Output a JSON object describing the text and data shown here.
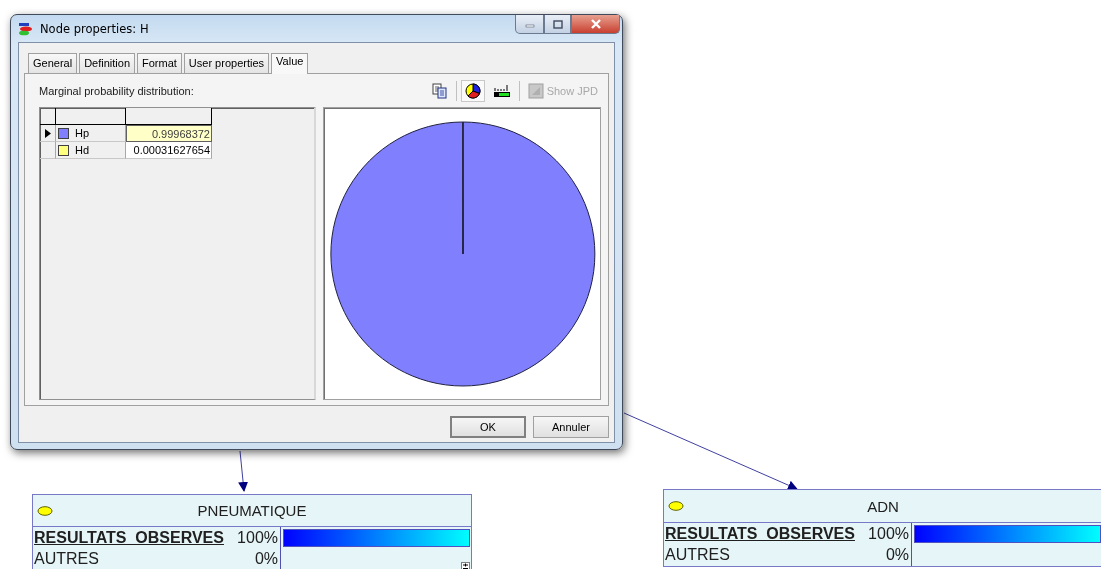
{
  "dialog": {
    "title": "Node properties: H",
    "tabs": [
      {
        "label": "General",
        "selected": false
      },
      {
        "label": "Definition",
        "selected": false
      },
      {
        "label": "Format",
        "selected": false
      },
      {
        "label": "User properties",
        "selected": false
      },
      {
        "label": "Value",
        "selected": true
      }
    ],
    "section_label": "Marginal probability distribution:",
    "toolbar": [
      {
        "kind": "copy",
        "selected": false
      },
      {
        "kind": "pie",
        "selected": true
      },
      {
        "kind": "bars",
        "selected": false
      },
      {
        "kind": "toggle",
        "label": "Show JPD",
        "selected": false,
        "disabled": true
      }
    ],
    "grid": {
      "rows": [
        {
          "state": "Hp",
          "color": "#8080ff",
          "value": "0.99968372",
          "current": true,
          "selected": true
        },
        {
          "state": "Hd",
          "color": "#ffff80",
          "value": "0.00031627654",
          "current": false,
          "selected": false
        }
      ]
    },
    "chart_data": {
      "type": "pie",
      "values": [
        0.99968372,
        0.00031627654
      ]
    },
    "buttons": [
      "OK",
      "Annuler"
    ]
  },
  "nodes": [
    {
      "title": "PNEUMATIQUE",
      "expander": true,
      "states": [
        {
          "label": "RESULTATS_OBSERVES",
          "percent": "100%",
          "level": 1,
          "selected": true
        },
        {
          "label": "AUTRES",
          "percent": "0%",
          "selected": false
        }
      ]
    },
    {
      "title": "ADN",
      "expander": false,
      "states": [
        {
          "label": "RESULTATS_OBSERVES",
          "percent": "100%",
          "level": 1,
          "selected": true
        },
        {
          "label": "AUTRES",
          "percent": "0%",
          "selected": false
        }
      ]
    }
  ]
}
